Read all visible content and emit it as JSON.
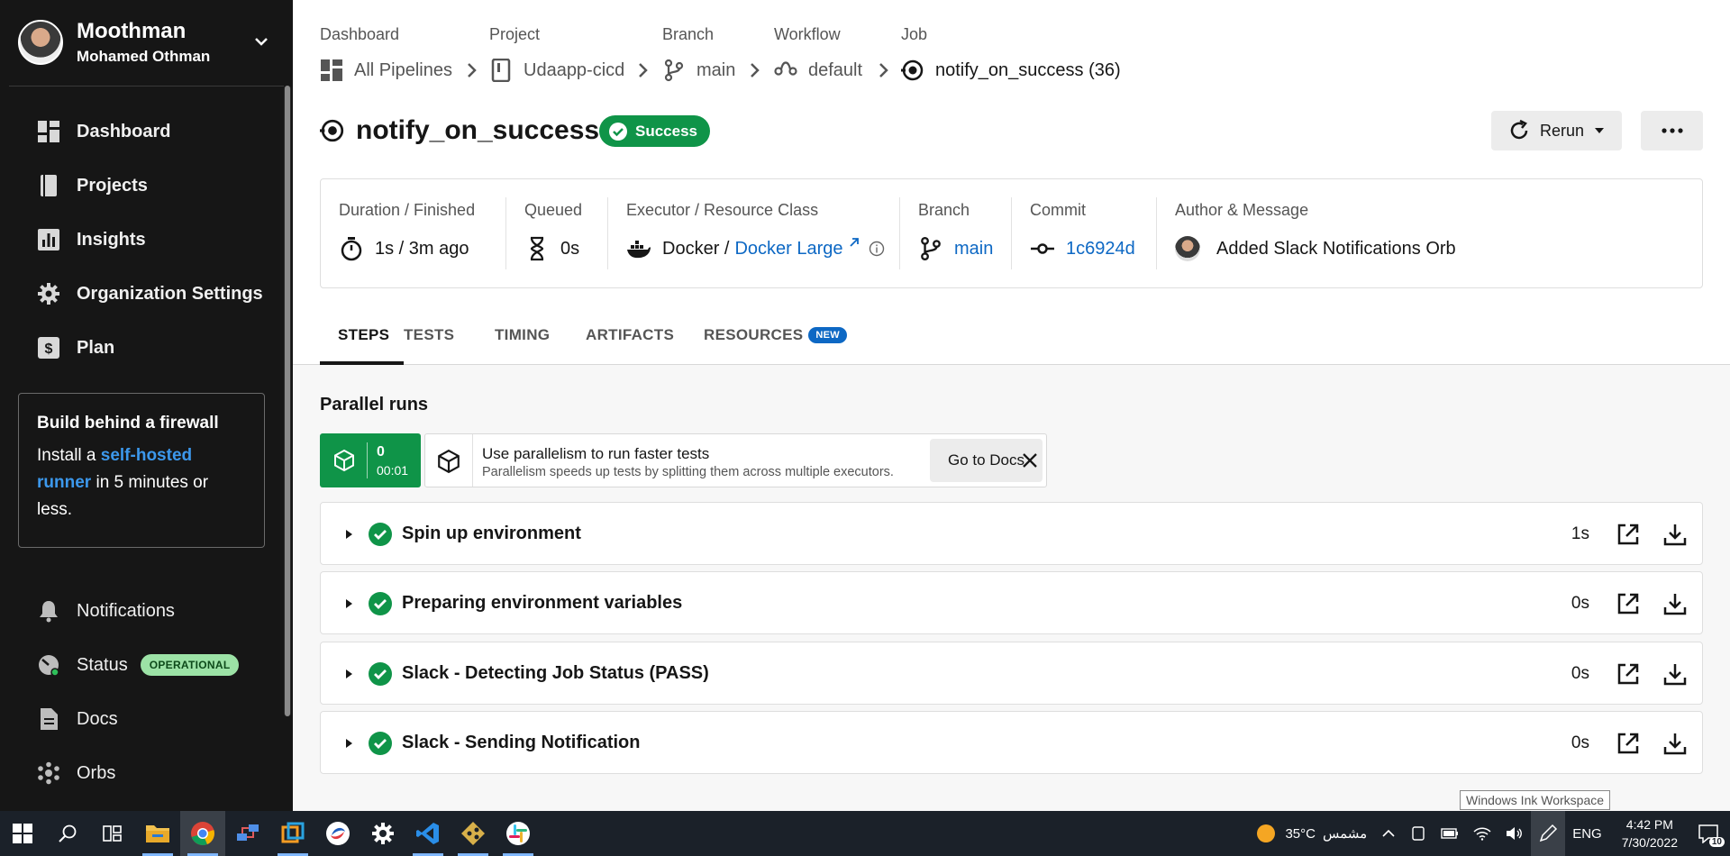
{
  "sidebar": {
    "user": {
      "org": "Moothman",
      "name": "Mohamed Othman"
    },
    "nav": [
      {
        "label": "Dashboard"
      },
      {
        "label": "Projects"
      },
      {
        "label": "Insights"
      },
      {
        "label": "Organization Settings"
      },
      {
        "label": "Plan"
      }
    ],
    "firewall": {
      "title": "Build behind a firewall",
      "text_before": "Install a ",
      "link": "self-hosted runner",
      "text_after": " in 5 minutes or less."
    },
    "bottom_nav": {
      "notifications": "Notifications",
      "status": "Status",
      "status_badge": "OPERATIONAL",
      "docs": "Docs",
      "orbs": "Orbs"
    }
  },
  "breadcrumb": {
    "labels": [
      "Dashboard",
      "Project",
      "Branch",
      "Workflow",
      "Job"
    ],
    "items": [
      "All Pipelines",
      "Udaapp-cicd",
      "main",
      "default",
      "notify_on_success (36)"
    ]
  },
  "job": {
    "title": "notify_on_success",
    "status": "Success",
    "rerun_label": "Rerun"
  },
  "info": {
    "duration": {
      "label": "Duration / Finished",
      "value": "1s / 3m ago"
    },
    "queued": {
      "label": "Queued",
      "value": "0s"
    },
    "executor": {
      "label": "Executor / Resource Class",
      "value": "Docker / ",
      "link": "Docker Large"
    },
    "branch": {
      "label": "Branch",
      "value": "main"
    },
    "commit": {
      "label": "Commit",
      "value": "1c6924d"
    },
    "author": {
      "label": "Author & Message",
      "value": "Added Slack Notifications Orb"
    }
  },
  "tabs": [
    "STEPS",
    "TESTS",
    "TIMING",
    "ARTIFACTS",
    "RESOURCES"
  ],
  "tabs_new_badge": "NEW",
  "parallel": {
    "title": "Parallel runs",
    "run_index": "0",
    "run_time": "00:01",
    "tip_title": "Use parallelism to run faster tests",
    "tip_sub": "Parallelism speeds up tests by splitting them across multiple executors.",
    "docs_button": "Go to Docs"
  },
  "steps": [
    {
      "name": "Spin up environment",
      "duration": "1s"
    },
    {
      "name": "Preparing environment variables",
      "duration": "0s"
    },
    {
      "name": "Slack - Detecting Job Status (PASS)",
      "duration": "0s"
    },
    {
      "name": "Slack - Sending Notification",
      "duration": "0s"
    }
  ],
  "tooltip": "Windows Ink Workspace",
  "taskbar": {
    "weather_temp": "35°C",
    "weather_text": "مشمس",
    "language": "ENG",
    "time": "4:42 PM",
    "date": "7/30/2022",
    "notification_count": "10"
  },
  "colors": {
    "success": "#0f9448",
    "link": "#0d68c4",
    "sidebar_bg": "#161616",
    "accent_link": "#3c98ec"
  }
}
